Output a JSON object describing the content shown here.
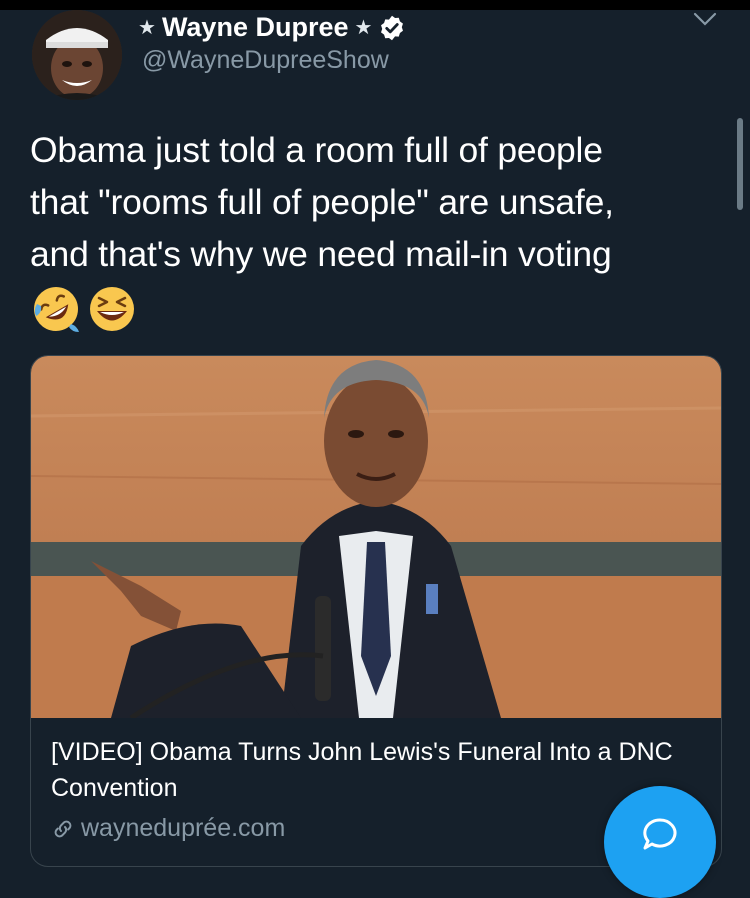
{
  "tweet": {
    "author_name": "Wayne Dupree",
    "star_left": "★",
    "star_right": "★",
    "handle": "@WayneDupreeShow",
    "text": "Obama just told a room full of people\nthat \"rooms full of people\" are unsafe,\nand that's why we need mail-in voting",
    "emojis": [
      "rolling-on-floor-laughing-emoji",
      "grinning-squinting-face-emoji"
    ]
  },
  "card": {
    "title": "[VIDEO] Obama Turns John Lewis's Funeral Into a DNC Convention",
    "domain": "wayneduprée.com"
  },
  "icons": {
    "verified": "verified-badge-icon",
    "chevron": "chevron-down-icon",
    "link": "link-icon",
    "compose": "compose-reply-icon"
  },
  "colors": {
    "background": "#15202b",
    "secondary_text": "#8899a6",
    "accent": "#1da1f2",
    "border": "#38444d"
  }
}
